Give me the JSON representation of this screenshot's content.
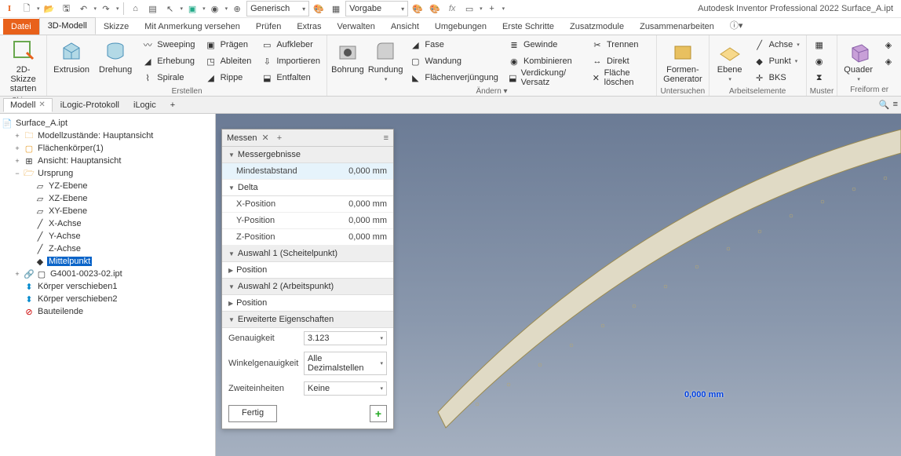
{
  "title": "Autodesk Inventor Professional 2022    Surface_A.ipt",
  "qat_combo1": "Generisch",
  "qat_combo2": "Vorgabe",
  "tabs": {
    "datei": "Datei",
    "active": "3D-Modell",
    "others": [
      "Skizze",
      "Mit Anmerkung versehen",
      "Prüfen",
      "Extras",
      "Verwalten",
      "Ansicht",
      "Umgebungen",
      "Erste Schritte",
      "Zusatzmodule",
      "Zusammenarbeiten"
    ]
  },
  "ribbon": {
    "skizze": {
      "btn": "2D-Skizze\nstarten",
      "label": "Skizze"
    },
    "erstellen": {
      "extrusion": "Extrusion",
      "drehung": "Drehung",
      "sweeping": "Sweeping",
      "erhebung": "Erhebung",
      "spirale": "Spirale",
      "praegen": "Prägen",
      "ableiten": "Ableiten",
      "rippe": "Rippe",
      "aufkleber": "Aufkleber",
      "importieren": "Importieren",
      "entfalten": "Entfalten",
      "label": "Erstellen"
    },
    "aendern": {
      "bohrung": "Bohrung",
      "rundung": "Rundung",
      "fase": "Fase",
      "wandung": "Wandung",
      "flaechen": "Flächenverjüngung",
      "gewinde": "Gewinde",
      "kombinieren": "Kombinieren",
      "verdickung": "Verdickung/ Versatz",
      "trennen": "Trennen",
      "direkt": "Direkt",
      "loeschen": "Fläche löschen",
      "label": "Ändern ▾"
    },
    "formen": {
      "btn": "Formen-\nGenerator",
      "label": "Untersuchen"
    },
    "ebene": {
      "btn": "Ebene",
      "achse": "Achse",
      "punkt": "Punkt",
      "bks": "BKS",
      "label": "Arbeitselemente"
    },
    "muster": {
      "label": "Muster"
    },
    "quader": {
      "btn": "Quader",
      "label": "Freiform er"
    }
  },
  "docTabs": {
    "t1": "Modell",
    "t2": "iLogic-Protokoll",
    "t3": "iLogic"
  },
  "tree": {
    "root": "Surface_A.ipt",
    "n1": "Modellzustände: Hauptansicht",
    "n2": "Flächenkörper(1)",
    "n3": "Ansicht: Hauptansicht",
    "n4": "Ursprung",
    "n4a": "YZ-Ebene",
    "n4b": "XZ-Ebene",
    "n4c": "XY-Ebene",
    "n4d": "X-Achse",
    "n4e": "Y-Achse",
    "n4f": "Z-Achse",
    "n4g": "Mittelpunkt",
    "n5": "G4001-0023-02.ipt",
    "n6": "Körper verschieben1",
    "n7": "Körper verschieben2",
    "n8": "Bauteilende"
  },
  "measure": {
    "title": "Messen",
    "s1": "Messergebnisse",
    "r1k": "Mindestabstand",
    "r1v": "0,000 mm",
    "s2": "Delta",
    "r2k": "X-Position",
    "r2v": "0,000 mm",
    "r3k": "Y-Position",
    "r3v": "0,000 mm",
    "r4k": "Z-Position",
    "r4v": "0,000 mm",
    "s3": "Auswahl 1 (Scheitelpunkt)",
    "s3a": "Position",
    "s4": "Auswahl 2 (Arbeitspunkt)",
    "s4a": "Position",
    "s5": "Erweiterte Eigenschaften",
    "p1k": "Genauigkeit",
    "p1v": "3.123",
    "p2k": "Winkelgenauigkeit",
    "p2v": "Alle Dezimalstellen",
    "p3k": "Zweiteinheiten",
    "p3v": "Keine",
    "done": "Fertig"
  },
  "dim": "0,000 mm"
}
